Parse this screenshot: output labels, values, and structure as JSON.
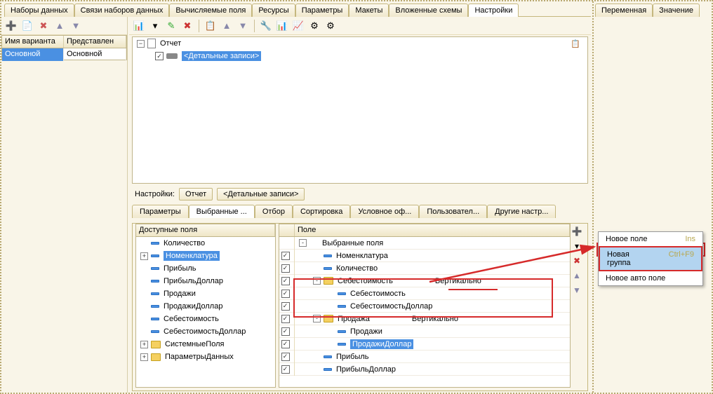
{
  "main_tabs": [
    "Наборы данных",
    "Связи наборов данных",
    "Вычисляемые поля",
    "Ресурсы",
    "Параметры",
    "Макеты",
    "Вложенные схемы",
    "Настройки"
  ],
  "main_active_tab": 7,
  "right_tabs": [
    "Переменная",
    "Значение"
  ],
  "variant_header": {
    "col1": "Имя варианта",
    "col2": "Представлен"
  },
  "variant_row": {
    "col1": "Основной",
    "col2": "Основной"
  },
  "report_tree": {
    "root_label": "Отчет",
    "child_label": "<Детальные записи>"
  },
  "settings_label": "Настройки:",
  "settings_path": [
    "Отчет",
    "<Детальные записи>"
  ],
  "detail_tabs": [
    "Параметры",
    "Выбранные ...",
    "Отбор",
    "Сортировка",
    "Условное оф...",
    "Пользовател...",
    "Другие настр..."
  ],
  "detail_active_tab": 1,
  "available_header": "Доступные поля",
  "available_fields": [
    {
      "name": "Количество",
      "exp": false,
      "type": "f"
    },
    {
      "name": "Номенклатура",
      "exp": true,
      "type": "f",
      "selected": true
    },
    {
      "name": "Прибыль",
      "exp": false,
      "type": "f"
    },
    {
      "name": "ПрибыльДоллар",
      "exp": false,
      "type": "f"
    },
    {
      "name": "Продажи",
      "exp": false,
      "type": "f"
    },
    {
      "name": "ПродажиДоллар",
      "exp": false,
      "type": "f"
    },
    {
      "name": "Себестоимость",
      "exp": false,
      "type": "f"
    },
    {
      "name": "СебестоимостьДоллар",
      "exp": false,
      "type": "f"
    },
    {
      "name": "СистемныеПоля",
      "exp": true,
      "type": "d"
    },
    {
      "name": "ПараметрыДанных",
      "exp": true,
      "type": "d"
    }
  ],
  "selected_header": "Поле",
  "selected_tree": [
    {
      "name": "Выбранные поля",
      "lvl": 0,
      "exp": "-",
      "type": "none",
      "chk": false
    },
    {
      "name": "Номенклатура",
      "lvl": 1,
      "type": "f",
      "chk": true
    },
    {
      "name": "Количество",
      "lvl": 1,
      "type": "f",
      "chk": true
    },
    {
      "name": "Себестоимость",
      "lvl": 1,
      "exp": "-",
      "type": "d",
      "chk": true,
      "extra": "Вертикально"
    },
    {
      "name": "Себестоимость",
      "lvl": 2,
      "type": "f",
      "chk": true
    },
    {
      "name": "СебестоимостьДоллар",
      "lvl": 2,
      "type": "f",
      "chk": true
    },
    {
      "name": "Продажа",
      "lvl": 1,
      "exp": "-",
      "type": "d",
      "chk": true,
      "extra": "Вертикально"
    },
    {
      "name": "Продажи",
      "lvl": 2,
      "type": "f",
      "chk": true
    },
    {
      "name": "ПродажиДоллар",
      "lvl": 2,
      "type": "f",
      "chk": true,
      "selected": true
    },
    {
      "name": "Прибыль",
      "lvl": 1,
      "type": "f",
      "chk": true
    },
    {
      "name": "ПрибыльДоллар",
      "lvl": 1,
      "type": "f",
      "chk": true
    }
  ],
  "context_menu": [
    {
      "label": "Новое поле",
      "shortcut": "Ins"
    },
    {
      "label": "Новая группа",
      "shortcut": "Ctrl+F9",
      "selected": true
    },
    {
      "label": "Новое авто поле",
      "shortcut": ""
    }
  ]
}
